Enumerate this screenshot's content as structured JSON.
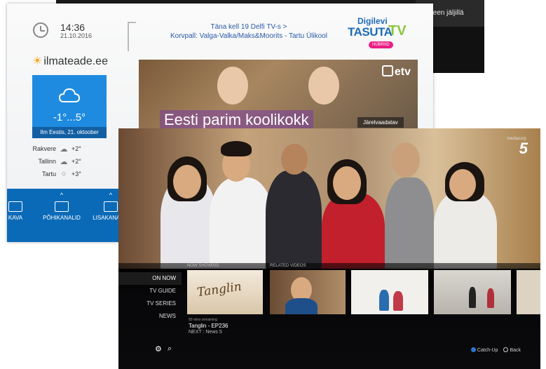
{
  "back_screen": {
    "bar_text": "onneen jäljillä"
  },
  "digilevi": {
    "time": "14:36",
    "date": "21.10.2016",
    "ticker_line1": "Täna kell 19 Delfi TV-s >",
    "ticker_line2": "Korvpall: Valga-Valka/Maks&Moorits - Tartu Ülikool",
    "logo_top": "Digilevi",
    "logo_main": "TASUTA",
    "logo_tv": "TV",
    "logo_badge": "HÜBRIID",
    "weather_site": "ilmateade.ee",
    "weather_temp": "-1°...5°",
    "weather_caption": "Ilm Eestis, 21. oktoober",
    "cities": [
      {
        "name": "Rakvere",
        "temp": "+2°",
        "icon": "partly-cloudy-icon"
      },
      {
        "name": "Tallinn",
        "temp": "+2°",
        "icon": "partly-cloudy-icon"
      },
      {
        "name": "Tartu",
        "temp": "+3°",
        "icon": "cloud-icon"
      }
    ],
    "nav": [
      {
        "label": "KAVA"
      },
      {
        "label": "PÕHIKANALID"
      },
      {
        "label": "LISAKANALID"
      }
    ],
    "channel_logo": "etv",
    "show_title": "Eesti parim koolikokk",
    "rewatch_label": "Järelvaadatav"
  },
  "mediacorp": {
    "channel_logo": "5",
    "brand": "mediacorp",
    "menu": [
      "ON NOW",
      "TV GUIDE",
      "TV SERIES",
      "NEWS"
    ],
    "now_showing_label": "NOW SHOWING",
    "related_label": "RELATED VIDEOS",
    "now_thumb_title": "Tanglin",
    "remaining": "50 mins remaining",
    "episode": "Tanglin - EP236",
    "next": "NEXT : News 5",
    "hint_catchup": "Catch-Up",
    "hint_back": "Back"
  }
}
